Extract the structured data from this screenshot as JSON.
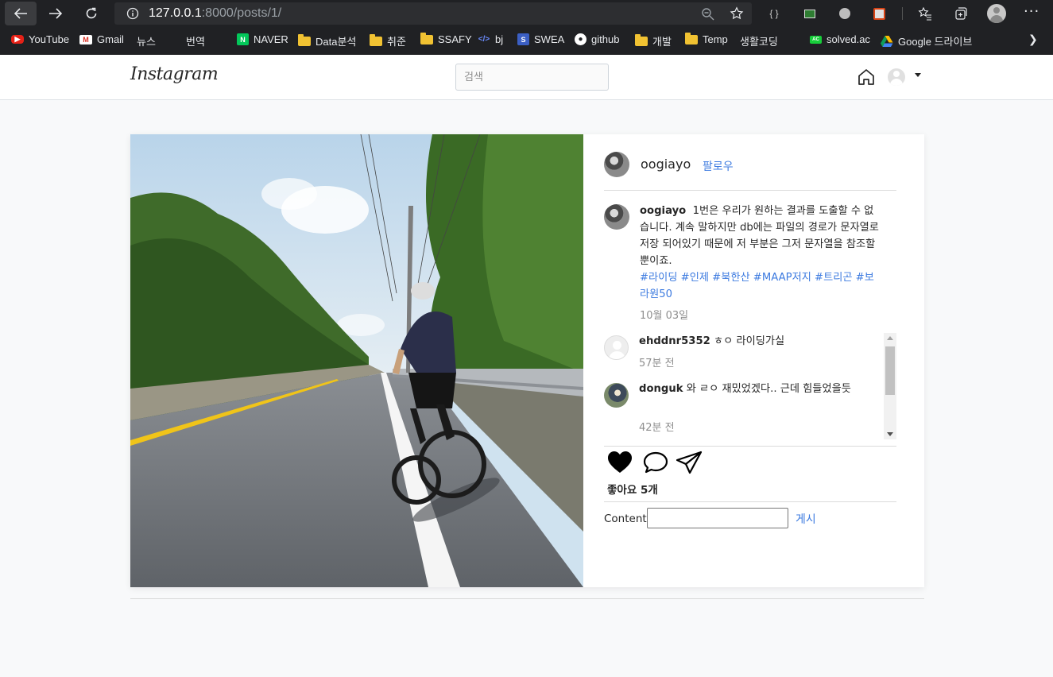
{
  "browser": {
    "url_host": "127.0.0.1",
    "url_rest": ":8000/posts/1/",
    "bookmarks": [
      {
        "label": "YouTube",
        "icon": "youtube-icon"
      },
      {
        "label": "Gmail",
        "icon": "gmail-icon"
      },
      {
        "label": "뉴스",
        "icon": "page-icon"
      },
      {
        "label": "번역",
        "icon": "page-icon"
      },
      {
        "label": "NAVER",
        "icon": "naver-icon"
      },
      {
        "label": "Data분석",
        "icon": "folder-icon"
      },
      {
        "label": "취준",
        "icon": "folder-icon"
      },
      {
        "label": "SSAFY",
        "icon": "folder-icon"
      },
      {
        "label": "bj",
        "icon": "code-icon"
      },
      {
        "label": "SWEA",
        "icon": "swea-icon"
      },
      {
        "label": "github",
        "icon": "github-icon"
      },
      {
        "label": "개발",
        "icon": "folder-icon"
      },
      {
        "label": "Temp",
        "icon": "folder-icon"
      },
      {
        "label": "생활코딩",
        "icon": "page-icon"
      },
      {
        "label": "solved.ac",
        "icon": "solvedac-icon"
      },
      {
        "label": "Google 드라이브",
        "icon": "google-drive-icon"
      }
    ]
  },
  "navbar": {
    "brand": "Instagram",
    "search_placeholder": "검색"
  },
  "post": {
    "author": "oogiayo",
    "follow_label": "팔로우",
    "caption_user": "oogiayo",
    "caption_text": "1번은 우리가 원하는 결과를 도출할 수 없습니다. 계속 말하지만 db에는 파일의 경로가 문자열로 저장 되어있기 때문에 저 부분은 그저 문자열을 참조할 뿐이죠.",
    "hashtags": "#라이딩 #인제 #북한산 #MAAP저지 #트리곤 #보라원50",
    "date": "10월 03일",
    "comments": [
      {
        "user": "ehddnr5352",
        "text": "ㅎㅇ 라이딩가실",
        "time": "57분 전"
      },
      {
        "user": "donguk",
        "text": "와 ㄹㅇ 재밌었겠다.. 근데 힘들었을듯",
        "time": "42분 전"
      }
    ],
    "likes_label": "좋아요 5개",
    "form": {
      "label": "Content:",
      "value": "",
      "submit_label": "게시"
    }
  },
  "colors": {
    "link_blue": "#3d7be0",
    "chrome_bg": "#202124"
  }
}
